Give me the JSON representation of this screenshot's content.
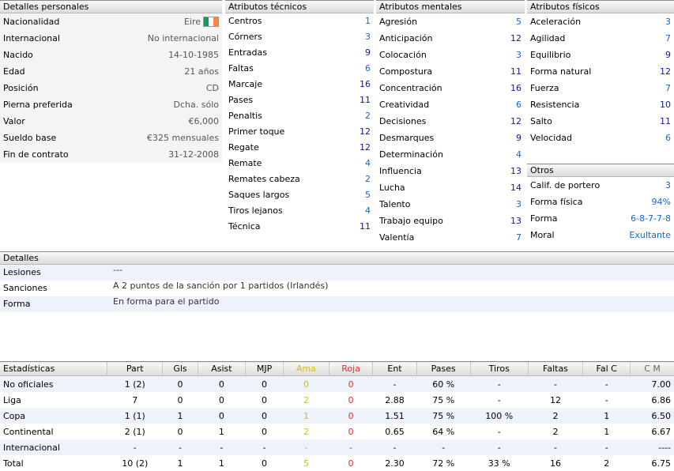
{
  "personal": {
    "title": "Detalles personales",
    "rows": [
      {
        "label": "Nacionalidad",
        "value": "Eire"
      },
      {
        "label": "Internacional",
        "value": "No internacional"
      },
      {
        "label": "Nacido",
        "value": "14-10-1985"
      },
      {
        "label": "Edad",
        "value": "21 años"
      },
      {
        "label": "Posición",
        "value": "CD"
      },
      {
        "label": "Pierna preferida",
        "value": "Dcha. sólo"
      },
      {
        "label": "Valor",
        "value": "€6,000"
      },
      {
        "label": "Sueldo base",
        "value": "€325 mensuales"
      },
      {
        "label": "Fin de contrato",
        "value": "31-12-2008"
      }
    ]
  },
  "tech": {
    "title": "Atributos técnicos",
    "rows": [
      {
        "label": "Centros",
        "value": "1"
      },
      {
        "label": "Córners",
        "value": "3"
      },
      {
        "label": "Entradas",
        "value": "9"
      },
      {
        "label": "Faltas",
        "value": "6"
      },
      {
        "label": "Marcaje",
        "value": "16"
      },
      {
        "label": "Pases",
        "value": "11"
      },
      {
        "label": "Penaltis",
        "value": "2"
      },
      {
        "label": "Primer toque",
        "value": "12"
      },
      {
        "label": "Regate",
        "value": "12"
      },
      {
        "label": "Remate",
        "value": "4"
      },
      {
        "label": "Remates cabeza",
        "value": "2"
      },
      {
        "label": "Saques largos",
        "value": "5"
      },
      {
        "label": "Tiros lejanos",
        "value": "4"
      },
      {
        "label": "Técnica",
        "value": "11"
      }
    ]
  },
  "mental": {
    "title": "Atributos mentales",
    "rows": [
      {
        "label": "Agresión",
        "value": "5"
      },
      {
        "label": "Anticipación",
        "value": "12"
      },
      {
        "label": "Colocación",
        "value": "3"
      },
      {
        "label": "Compostura",
        "value": "11"
      },
      {
        "label": "Concentración",
        "value": "16"
      },
      {
        "label": "Creatividad",
        "value": "6"
      },
      {
        "label": "Decisiones",
        "value": "12"
      },
      {
        "label": "Desmarques",
        "value": "9"
      },
      {
        "label": "Determinación",
        "value": "4"
      },
      {
        "label": "Influencia",
        "value": "13"
      },
      {
        "label": "Lucha",
        "value": "14"
      },
      {
        "label": "Talento",
        "value": "3"
      },
      {
        "label": "Trabajo equipo",
        "value": "13"
      },
      {
        "label": "Valentía",
        "value": "7"
      }
    ]
  },
  "phys": {
    "title": "Atributos físicos",
    "rows": [
      {
        "label": "Aceleración",
        "value": "3"
      },
      {
        "label": "Agilidad",
        "value": "7"
      },
      {
        "label": "Equilibrio",
        "value": "9"
      },
      {
        "label": "Forma natural",
        "value": "12"
      },
      {
        "label": "Fuerza",
        "value": "7"
      },
      {
        "label": "Resistencia",
        "value": "10"
      },
      {
        "label": "Salto",
        "value": "11"
      },
      {
        "label": "Velocidad",
        "value": "6"
      }
    ]
  },
  "otros": {
    "title": "Otros",
    "rows": [
      {
        "label": "Calif. de portero",
        "value": "3"
      },
      {
        "label": "Forma física",
        "value": "94%"
      },
      {
        "label": "Forma",
        "value": "6-8-7-7-8"
      },
      {
        "label": "Moral",
        "value": "Exultante"
      }
    ]
  },
  "detalles": {
    "title": "Detalles",
    "rows": [
      {
        "label": "Lesiones",
        "value": "---"
      },
      {
        "label": "Sanciones",
        "value": "A 2 puntos de la sanción por 1 partidos (Irlandés)"
      },
      {
        "label": "Forma",
        "value": "En forma para el partido"
      }
    ]
  },
  "stats": {
    "headers": [
      "Estadísticas",
      "Part",
      "Gls",
      "Asist",
      "MJP",
      "Ama",
      "Roja",
      "Ent",
      "Pases",
      "Tiros",
      "Faltas",
      "Fal C",
      "C M"
    ],
    "rows": [
      [
        "No oficiales",
        "1 (2)",
        "0",
        "0",
        "0",
        "0",
        "0",
        "-",
        "60 %",
        "-",
        "-",
        "-",
        "7.00"
      ],
      [
        "Liga",
        "7",
        "0",
        "0",
        "0",
        "2",
        "0",
        "2.88",
        "75 %",
        "-",
        "12",
        "-",
        "6.86"
      ],
      [
        "Copa",
        "1 (1)",
        "1",
        "0",
        "0",
        "1",
        "0",
        "1.51",
        "75 %",
        "100 %",
        "2",
        "1",
        "6.50"
      ],
      [
        "Continental",
        "2 (1)",
        "0",
        "1",
        "0",
        "2",
        "0",
        "0.65",
        "64 %",
        "-",
        "2",
        "1",
        "6.67"
      ],
      [
        "Internacional",
        "-",
        "-",
        "-",
        "-",
        "-",
        "-",
        "-",
        "-",
        "-",
        "-",
        "-",
        "----"
      ],
      [
        "Total",
        "10 (2)",
        "1",
        "1",
        "0",
        "5",
        "0",
        "2.30",
        "72 %",
        "33 %",
        "16",
        "2",
        "6.75"
      ]
    ]
  }
}
